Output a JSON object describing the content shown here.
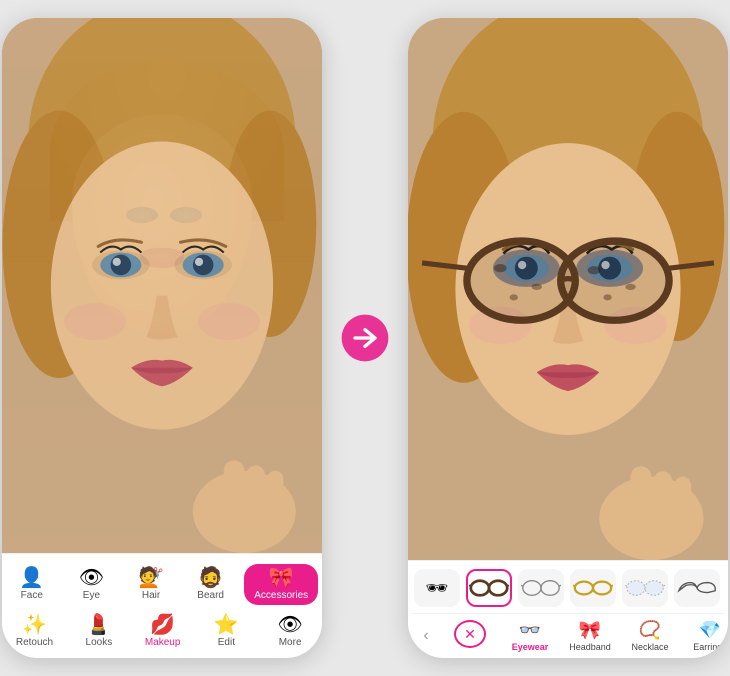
{
  "leftPhone": {
    "navRows": [
      [
        {
          "id": "face",
          "icon": "👤",
          "label": "Face",
          "active": false
        },
        {
          "id": "eye",
          "icon": "👁",
          "label": "Eye",
          "active": false
        },
        {
          "id": "hair",
          "icon": "💇",
          "label": "Hair",
          "active": false
        },
        {
          "id": "beard",
          "icon": "🧔",
          "label": "Beard",
          "active": false
        },
        {
          "id": "accessories",
          "icon": "🎀",
          "label": "Accessories",
          "active": true
        }
      ],
      [
        {
          "id": "retouch",
          "icon": "✨",
          "label": "Retouch",
          "active": false
        },
        {
          "id": "looks",
          "icon": "💄",
          "label": "Looks",
          "active": false
        },
        {
          "id": "makeup",
          "icon": "💋",
          "label": "Makeup",
          "active": false
        },
        {
          "id": "edit",
          "icon": "⭐",
          "label": "Edit",
          "active": false
        },
        {
          "id": "more",
          "icon": "👁",
          "label": "More",
          "active": false
        }
      ]
    ]
  },
  "arrow": "→",
  "rightPhone": {
    "glassesSwatch": [
      {
        "id": "all",
        "icon": "🕶",
        "isAll": true
      },
      {
        "id": "tortoise",
        "label": "",
        "selected": true
      },
      {
        "id": "wire",
        "label": ""
      },
      {
        "id": "gold",
        "label": ""
      },
      {
        "id": "rimless",
        "label": ""
      },
      {
        "id": "cat",
        "label": ""
      }
    ],
    "categories": [
      {
        "id": "remove",
        "icon": "❌",
        "label": "",
        "isRemove": true
      },
      {
        "id": "eyewear",
        "icon": "👓",
        "label": "Eyewear",
        "active": true
      },
      {
        "id": "headband",
        "icon": "🎀",
        "label": "Headband"
      },
      {
        "id": "necklace",
        "icon": "📿",
        "label": "Necklace"
      },
      {
        "id": "earrings",
        "icon": "💎",
        "label": "Earrings"
      }
    ]
  },
  "colors": {
    "accent": "#e91e8c",
    "activeNavBg": "#e91e8c",
    "white": "#ffffff"
  }
}
